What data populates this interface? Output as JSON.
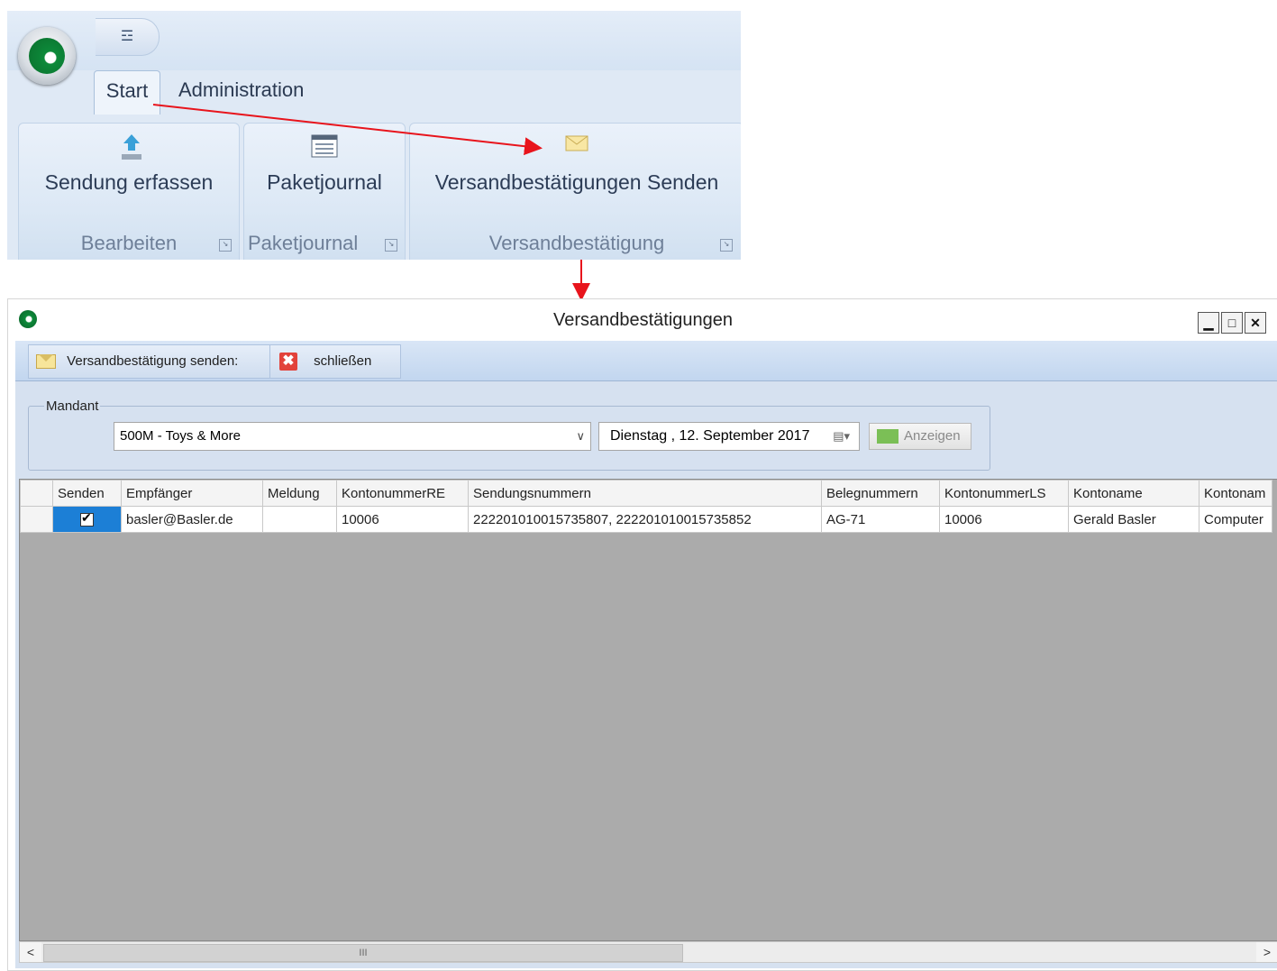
{
  "ribbon": {
    "qat_label": "☲",
    "tabs": [
      "Start",
      "Administration"
    ],
    "groups": [
      {
        "button": "Sendung erfassen",
        "label": "Bearbeiten",
        "icon": "upload-icon"
      },
      {
        "button": "Paketjournal",
        "label": "Paketjournal",
        "icon": "journal-icon"
      },
      {
        "button": "Versandbestätigungen Senden",
        "label": "Versandbestätigung",
        "icon": "envelope-icon"
      }
    ]
  },
  "window": {
    "title": "Versandbestätigungen",
    "controls": {
      "minimize": "▁",
      "maximize": "□",
      "close": "✕"
    }
  },
  "toolbar": {
    "send_label": "Versandbestätigung senden:",
    "close_label": "schließen",
    "close_icon": "✖"
  },
  "filter": {
    "legend": "Mandant",
    "mandant_value": "500M - Toys & More",
    "date_value": "Dienstag   , 12. September 2017",
    "show_label": "Anzeigen"
  },
  "grid": {
    "columns": [
      "Senden",
      "Empfänger",
      "Meldung",
      "KontonummerRE",
      "Sendungsnummern",
      "Belegnummern",
      "KontonummerLS",
      "Kontoname",
      "Kontonam"
    ],
    "rows": [
      {
        "senden": true,
        "empfaenger": "basler@Basler.de",
        "meldung": "",
        "kontonummer_re": "10006",
        "sendungsnummern": "222201010015735807, 222201010015735852",
        "belegnummern": "AG-71",
        "kontonummer_ls": "10006",
        "kontoname": "Gerald Basler",
        "kontoname2": "Computer"
      }
    ]
  },
  "scrollbar": {
    "left": "<",
    "right": ">",
    "grip": "III"
  },
  "colors": {
    "arrow": "#e8141c",
    "selection": "#1c7fd6",
    "grid_empty": "#ababab"
  }
}
